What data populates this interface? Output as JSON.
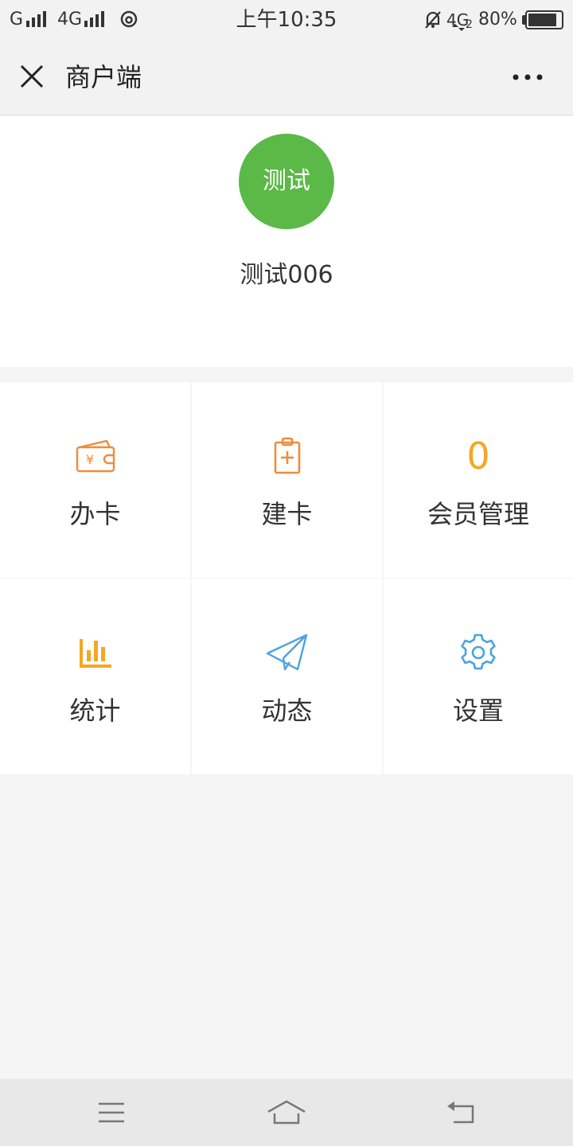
{
  "status_bar": {
    "carrier1": "G",
    "carrier2": "4G",
    "time": "上午10:35",
    "network": "4G",
    "network_sub": "2",
    "battery": "80%",
    "battery_level": 0.8
  },
  "nav": {
    "title": "商户端",
    "close_icon": "close-icon",
    "more_icon": "more-icon"
  },
  "profile": {
    "avatar_text": "测试",
    "name": "测试006",
    "avatar_color": "#5bb947"
  },
  "grid": {
    "items": [
      {
        "label": "办卡",
        "icon": "wallet-icon",
        "color": "#f08c3a"
      },
      {
        "label": "建卡",
        "icon": "clipboard-add-icon",
        "color": "#f08c3a"
      },
      {
        "label": "会员管理",
        "count": "0",
        "color": "#f5a623"
      },
      {
        "label": "统计",
        "icon": "bar-chart-icon",
        "color": "#f5a623"
      },
      {
        "label": "动态",
        "icon": "paper-plane-icon",
        "color": "#4aa3df"
      },
      {
        "label": "设置",
        "icon": "gear-icon",
        "color": "#4aa3df"
      }
    ]
  },
  "system_nav": {
    "menu_icon": "menu-icon",
    "home_icon": "home-icon",
    "back_icon": "back-icon"
  }
}
